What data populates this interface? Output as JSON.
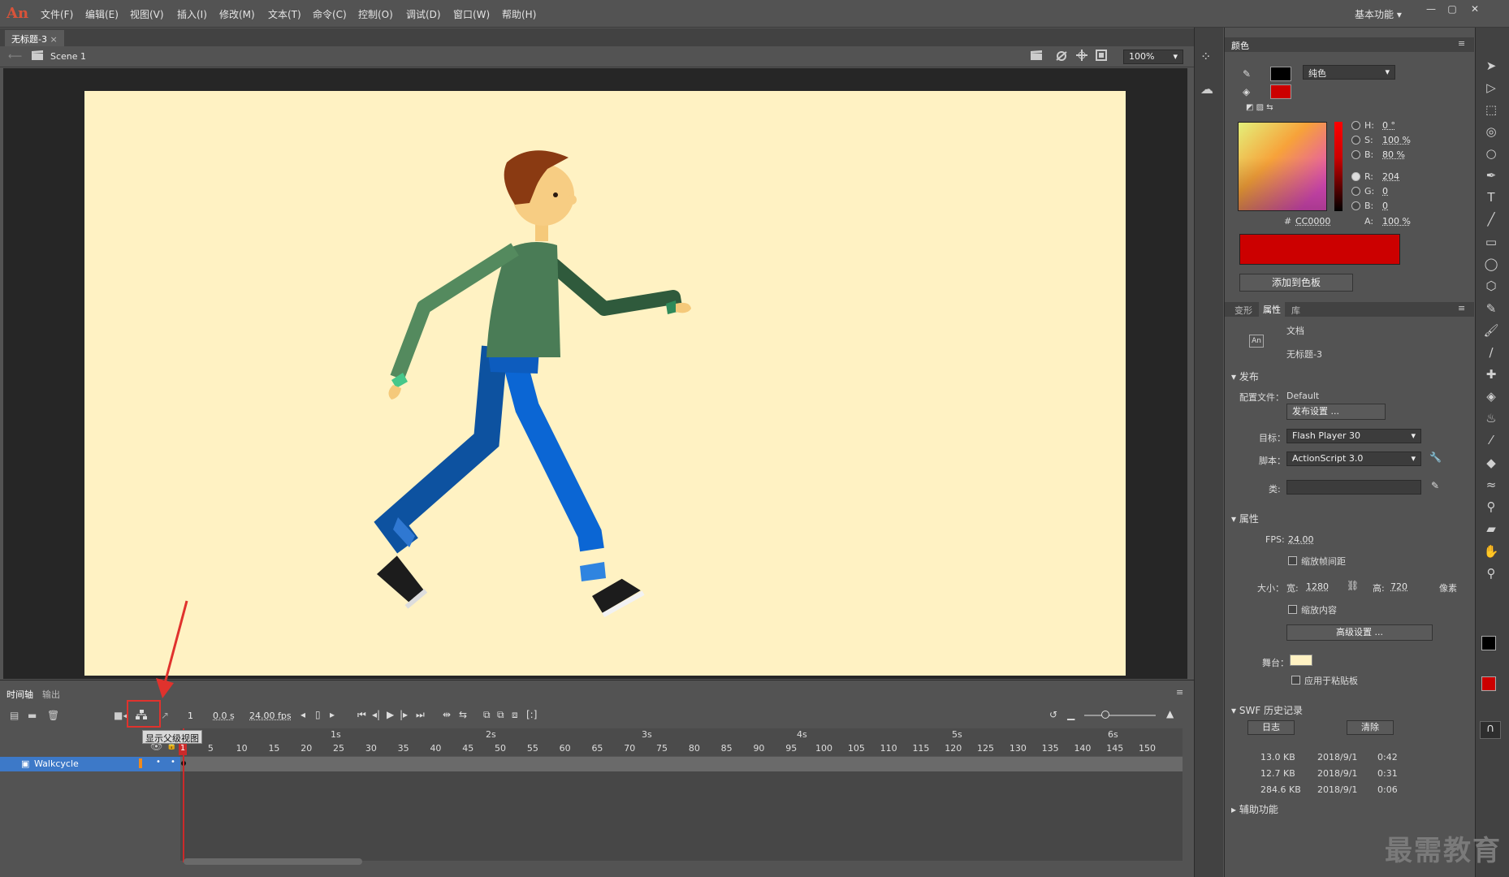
{
  "app": {
    "logo": "An"
  },
  "menu": [
    "文件(F)",
    "编辑(E)",
    "视图(V)",
    "插入(I)",
    "修改(M)",
    "文本(T)",
    "命令(C)",
    "控制(O)",
    "调试(D)",
    "窗口(W)",
    "帮助(H)"
  ],
  "workspace": "基本功能",
  "document": {
    "tab": "无标题-3",
    "scene": "Scene 1",
    "zoom": "100%"
  },
  "timeline": {
    "tabs": [
      "时间轴",
      "输出"
    ],
    "frame": "1",
    "time": "0.0 s",
    "fps": "24.00 fps",
    "tooltip": "显示父级视图",
    "seconds": [
      "1s",
      "2s",
      "3s",
      "4s",
      "5s",
      "6s"
    ],
    "frame_numbers": [
      "1",
      "5",
      "10",
      "15",
      "20",
      "25",
      "30",
      "35",
      "40",
      "45",
      "50",
      "55",
      "60",
      "65",
      "70",
      "75",
      "80",
      "85",
      "90",
      "95",
      "100",
      "105",
      "110",
      "115",
      "120",
      "125",
      "130",
      "135",
      "140",
      "145",
      "150"
    ],
    "layer": "Walkcycle"
  },
  "color_panel": {
    "tab": "颜色",
    "fill_type": "纯色",
    "H_label": "H:",
    "H": "0 °",
    "S_label": "S:",
    "S": "100 %",
    "B_label": "B:",
    "B": "80 %",
    "R_label": "R:",
    "R": "204",
    "G_label": "G:",
    "G": "0",
    "Bb_label": "B:",
    "Bb": "0",
    "A_label": "A:",
    "A": "100 %",
    "hex_label": "#",
    "hex": "CC0000",
    "add_swatch": "添加到色板",
    "stroke_color": "#000000",
    "fill_color": "#cc0000"
  },
  "props_panel": {
    "tabs": [
      "变形",
      "属性",
      "库"
    ],
    "doc_icon": "An",
    "doc_type": "文档",
    "doc_name": "无标题-3",
    "publish_head": "发布",
    "profile_label": "配置文件：",
    "profile": "Default",
    "publish_settings": "发布设置 ...",
    "target_label": "目标：",
    "target": "Flash Player 30",
    "script_label": "脚本：",
    "script": "ActionScript 3.0",
    "class_label": "类:",
    "attr_head": "属性",
    "fps_label": "FPS:",
    "fps": "24.00",
    "scale_spans": "缩放帧间距",
    "size_label": "大小：",
    "width_label": "宽:",
    "width": "1280",
    "height_label": "高:",
    "height": "720",
    "unit": "像素",
    "scale_content": "缩放内容",
    "advanced": "高级设置 ...",
    "stage_label": "舞台：",
    "stage_color": "#fff2c3",
    "apply_paste": "应用于粘贴板",
    "swf_head": "SWF 历史记录",
    "log_btn": "日志",
    "clear_btn": "清除",
    "history": [
      {
        "size": "13.0 KB",
        "date": "2018/9/1",
        "time": "0:42"
      },
      {
        "size": "12.7 KB",
        "date": "2018/9/1",
        "time": "0:31"
      },
      {
        "size": "284.6 KB",
        "date": "2018/9/1",
        "time": "0:06"
      }
    ],
    "accessibility_head": "辅助功能"
  },
  "tools": [
    "selection-icon",
    "subselection-icon",
    "free-transform-icon",
    "3d-rotation-icon",
    "lasso-icon",
    "pen-icon",
    "text-icon",
    "line-icon",
    "rectangle-icon",
    "oval-icon",
    "polystar-icon",
    "pencil-icon",
    "paint-brush-icon",
    "brush-icon",
    "bone-icon",
    "paint-bucket-icon",
    "ink-bottle-icon",
    "eyedropper-icon",
    "eraser-icon",
    "width-icon",
    "pin-icon",
    "camera-icon",
    "hand-icon",
    "zoom-icon"
  ],
  "watermark": "最需教育"
}
